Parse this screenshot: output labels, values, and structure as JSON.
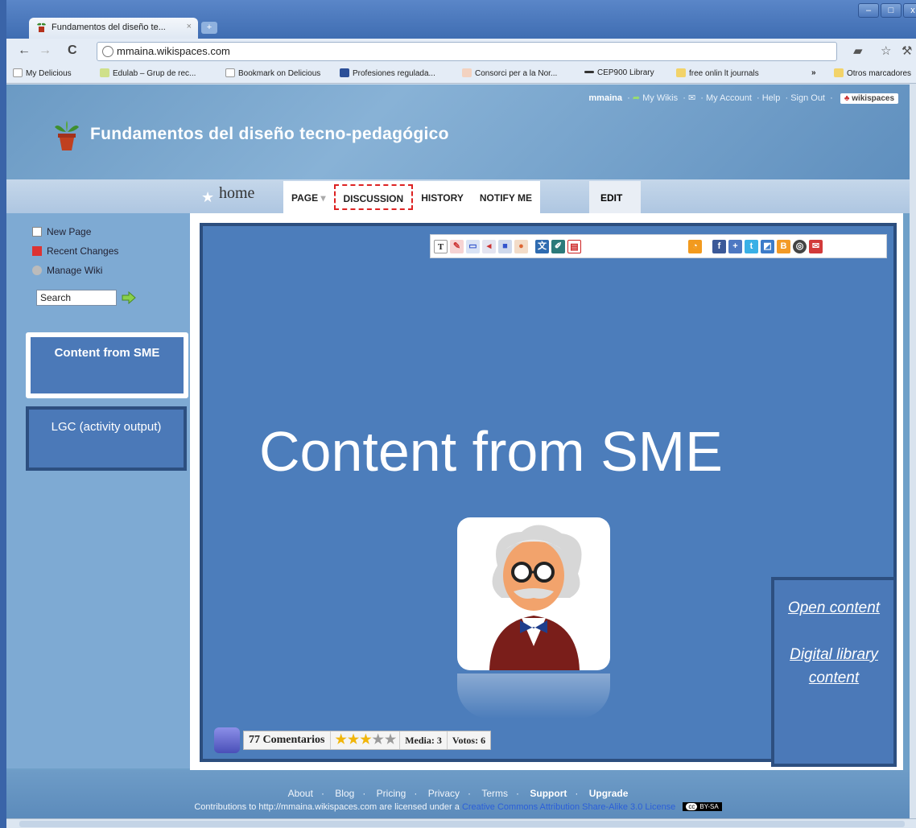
{
  "browser": {
    "tab_title": "Fundamentos del diseño te...",
    "tab_close": "×",
    "new_tab": "+",
    "url": "mmaina.wikispaces.com",
    "bookmarks": [
      {
        "label": "My Delicious"
      },
      {
        "label": "Edulab – Grup de rec..."
      },
      {
        "label": "Bookmark on Delicious"
      },
      {
        "label": "Profesiones regulada..."
      },
      {
        "label": "Consorci per a la Nor..."
      },
      {
        "label": "CEP900 Library"
      },
      {
        "label": "free onlin lt journals"
      },
      {
        "label": "Otros marcadores"
      }
    ],
    "bookmarks_overflow": "»"
  },
  "header": {
    "user": "mmaina",
    "my_wikis": "My Wikis",
    "my_account": "My Account",
    "help": "Help",
    "sign_out": "Sign Out",
    "brand": "wikispaces",
    "site_title": "Fundamentos del diseño tecno-pedagógico"
  },
  "nav": {
    "home": "home",
    "tabs": [
      "PAGE",
      "DISCUSSION",
      "HISTORY",
      "NOTIFY ME"
    ],
    "page_caret": "▾",
    "edit": "EDIT"
  },
  "sidebar": {
    "links": [
      "New Page",
      "Recent Changes",
      "Manage Wiki"
    ],
    "search_value": "Search",
    "sme_box": "Content from SME",
    "lgc_box": "LGC (activity output)"
  },
  "content": {
    "big_title": "Content from SME",
    "comments": {
      "count": "77 Comentarios",
      "rating_stars": 3,
      "rating_max": 5,
      "media": "Media: 3",
      "votos": "Votos: 6"
    },
    "links": [
      "Open content",
      "Digital library content"
    ]
  },
  "footer": {
    "links": [
      "About",
      "Blog",
      "Pricing",
      "Privacy",
      "Terms",
      "Support",
      "Upgrade"
    ],
    "license_prefix": "Contributions to http://mmaina.wikispaces.com are licensed under a",
    "license_link": "Creative Commons Attribution Share-Alike 3.0 License",
    "cc_badge": "BY-SA"
  },
  "colors": {
    "content_bg": "#4c7dbb",
    "box_border": "#2c4e7e",
    "discussion_highlight": "#dd2222"
  }
}
